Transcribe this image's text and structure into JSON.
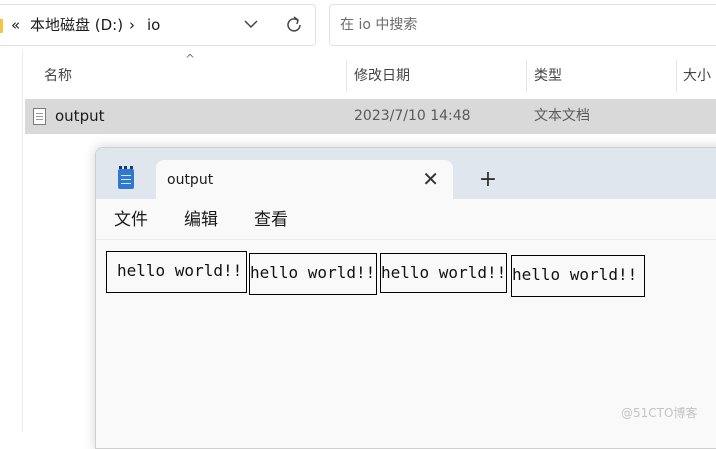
{
  "explorer": {
    "breadcrumb": {
      "overflow": "«",
      "drive": "本地磁盘 (D:)",
      "separator": "›",
      "folder": "io"
    },
    "search": {
      "placeholder": "在 io 中搜索"
    },
    "columns": [
      "名称",
      "修改日期",
      "类型",
      "大小"
    ],
    "sort_indicator": "^",
    "rows": [
      {
        "name": "output",
        "modified": "2023/7/10 14:48",
        "type": "文本文档"
      }
    ]
  },
  "notepad": {
    "tab_title": "output",
    "close_glyph": "✕",
    "new_tab_glyph": "+",
    "menu": [
      "文件",
      "编辑",
      "查看"
    ],
    "content_chunks": [
      "hello world!!",
      "hello world!!",
      "hello world!!",
      "hello world!!"
    ]
  },
  "watermark": "@51CTO博客",
  "colors": {
    "selected_row": "#d9d9d9",
    "tabbar": "#dfe6ee",
    "notepad_bg": "#f9f9f9",
    "logo": "#2f7ad1"
  }
}
